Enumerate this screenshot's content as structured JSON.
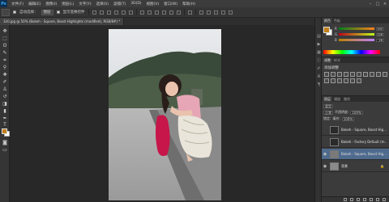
{
  "app": {
    "logo": "Ps",
    "menus": [
      "文件(F)",
      "编辑(E)",
      "图像(I)",
      "图层(L)",
      "文字(Y)",
      "选择(S)",
      "滤镜(T)",
      "3D(D)",
      "视图(V)",
      "窗口(W)",
      "帮助(H)"
    ],
    "window_controls": [
      "–",
      "□",
      "×"
    ]
  },
  "options": {
    "auto_select_label": "自动选择：",
    "auto_select_value": "图层",
    "show_transform_label": "显示变换控件"
  },
  "document": {
    "tab_title": "320.jpg @ 50% (Bokeh - Square, Boost Highlights (modified), RGB/8#) *"
  },
  "color_panel": {
    "tabs": [
      "颜色",
      "色板"
    ],
    "sliders": [
      {
        "label": "R",
        "value": "192",
        "color_from": "#00801a",
        "color_to": "#ff801a"
      },
      {
        "label": "G",
        "value": "128",
        "color_from": "#c0001a",
        "color_to": "#c0ff1a"
      },
      {
        "label": "B",
        "value": "26",
        "color_from": "#c08000",
        "color_to": "#c080ff"
      }
    ],
    "foreground_color": "#c0801a",
    "background_color": "#ffffff"
  },
  "adjustments_panel": {
    "tabs": [
      "调整",
      "样式"
    ],
    "title": "添加调整"
  },
  "layers_panel": {
    "tabs": [
      "图层",
      "通道",
      "路径"
    ],
    "filter_label": "类型",
    "blend_mode": "正常",
    "opacity_label": "不透明度:",
    "opacity_value": "100%",
    "lock_label": "锁定:",
    "fill_label": "填充:",
    "fill_value": "100%",
    "layers": [
      {
        "name": "Bokeh - Square, Boost Hig...",
        "visible": false,
        "selected": false
      },
      {
        "name": "Bokeh - Factory Default (m...",
        "visible": false,
        "selected": false
      },
      {
        "name": "Bokeh - Square, Boost Hig...",
        "visible": true,
        "selected": true
      },
      {
        "name": "背景",
        "visible": true,
        "selected": false,
        "locked": true
      }
    ]
  }
}
